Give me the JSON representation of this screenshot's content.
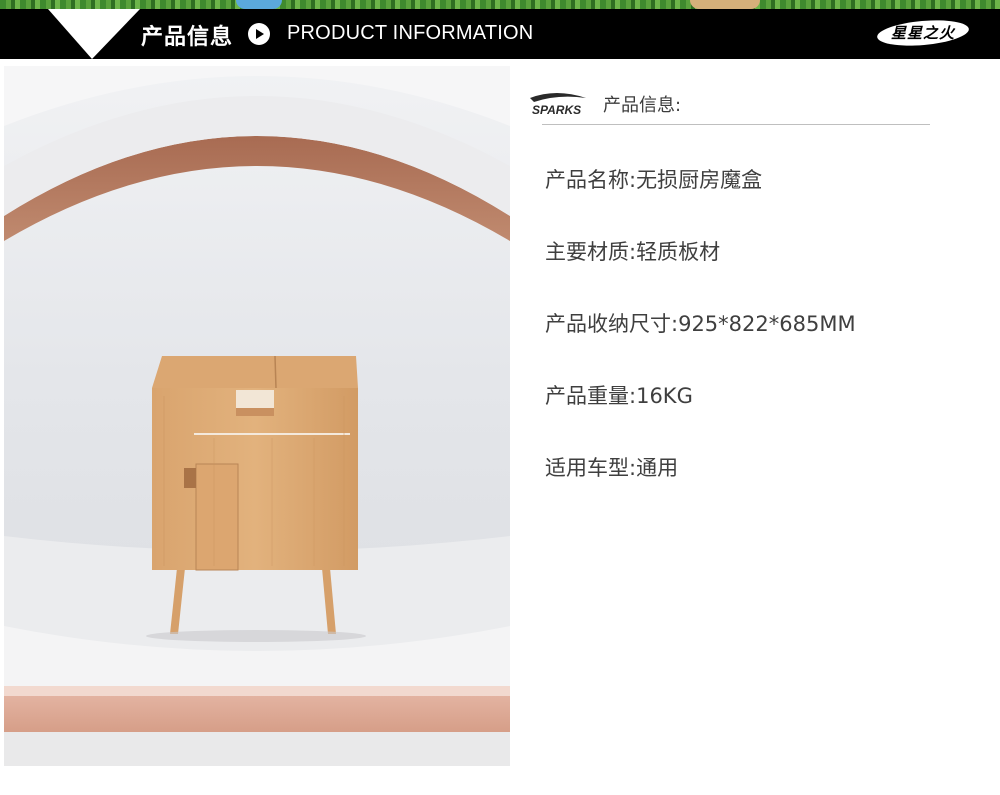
{
  "header": {
    "title_cn": "产品信息",
    "title_en": "PRODUCT INFORMATION",
    "arrow_icon": "play-circle-icon",
    "brand_logo_text": "星星之火"
  },
  "info": {
    "logo_text": "SPARKS",
    "section_title": "产品信息:",
    "specs": [
      {
        "label": "产品名称:",
        "value": "无损厨房魔盒"
      },
      {
        "label": "主要材质:",
        "value": "轻质板材"
      },
      {
        "label": "产品收纳尺寸:",
        "value": "925*822*685MM"
      },
      {
        "label": "产品重量:",
        "value": "16KG"
      },
      {
        "label": "适用车型:",
        "value": "通用"
      }
    ]
  },
  "colors": {
    "header_bg": "#000000",
    "accent_copper": "#b77a5c",
    "wood": "#d9a26c",
    "text": "#3f3f3f"
  }
}
